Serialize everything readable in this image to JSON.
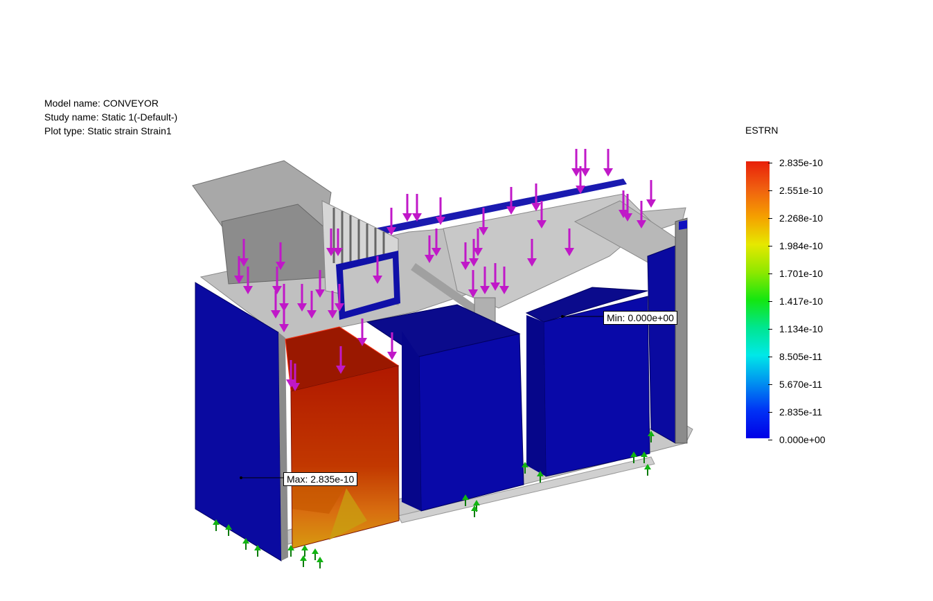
{
  "info": {
    "model_name": "Model name: CONVEYOR",
    "study_name": "Study name: Static 1(-Default-)",
    "plot_type": "Plot type: Static strain Strain1"
  },
  "legend": {
    "title": "ESTRN",
    "ticks": [
      "2.835e-10",
      "2.551e-10",
      "2.268e-10",
      "1.984e-10",
      "1.701e-10",
      "1.417e-10",
      "1.134e-10",
      "8.505e-11",
      "5.670e-11",
      "2.835e-11",
      "0.000e+00"
    ]
  },
  "callouts": {
    "max": "Max: 2.835e-10",
    "min": "Min: 0.000e+00"
  },
  "colors": {
    "frame_blue": "#0000a8",
    "max_red": "#c41a00",
    "load_arrow": "#c018c8",
    "fixture": "#12b412",
    "body_gray": "#b4b4b4"
  }
}
